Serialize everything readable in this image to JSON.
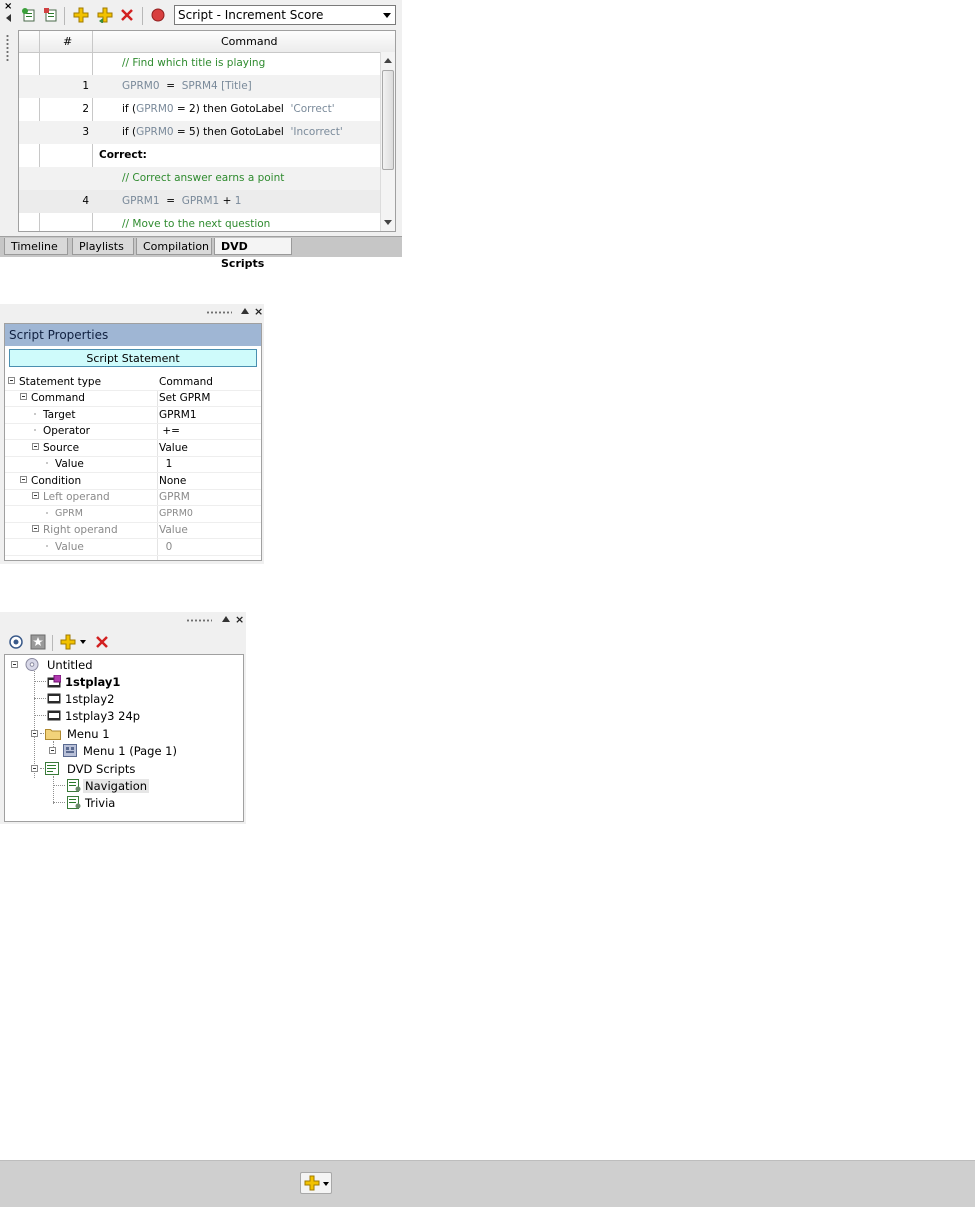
{
  "scripts_panel": {
    "script_selector": {
      "value": "Script - Increment Score"
    },
    "columns": {
      "num": "#",
      "command": "Command"
    },
    "rows": [
      {
        "num": "",
        "type": "comment",
        "text": "// Find which title is playing"
      },
      {
        "num": "1",
        "type": "assign",
        "lhs": "GPRM0",
        "op": "=",
        "rhs": "SPRM4 [Title]"
      },
      {
        "num": "2",
        "type": "if",
        "kw_if": "if (",
        "reg": "GPRM0",
        "cond": " = 2) then ",
        "go": "GotoLabel",
        "label": "'Correct'"
      },
      {
        "num": "3",
        "type": "if",
        "kw_if": "if (",
        "reg": "GPRM0",
        "cond": " = 5) then ",
        "go": "GotoLabel",
        "label": "'Incorrect'"
      },
      {
        "num": "",
        "type": "label",
        "text": "Correct:"
      },
      {
        "num": "",
        "type": "comment",
        "text": "// Correct answer earns a point"
      },
      {
        "num": "4",
        "type": "assign2",
        "lhs": "GPRM1",
        "op": "=",
        "rhs": "GPRM1",
        "plus": "+",
        "val": "1"
      },
      {
        "num": "",
        "type": "comment",
        "text": "// Move to the next question"
      }
    ],
    "tabs": [
      {
        "label": "Timeline",
        "active": false
      },
      {
        "label": "Playlists",
        "active": false
      },
      {
        "label": "Compilation",
        "active": false
      },
      {
        "label": "DVD Scripts",
        "active": true
      }
    ]
  },
  "props_panel": {
    "title": "Script Properties",
    "statement_button": "Script Statement",
    "rows": [
      {
        "key": "Statement type",
        "value": "Command",
        "indent": 0,
        "toggle": true,
        "dim": false
      },
      {
        "key": "Command",
        "value": "Set GPRM",
        "indent": 1,
        "toggle": true,
        "dim": false
      },
      {
        "key": "Target",
        "value": "GPRM1",
        "indent": 2,
        "toggle": false,
        "dim": false
      },
      {
        "key": "Operator",
        "value": " +=",
        "indent": 2,
        "toggle": false,
        "dim": false
      },
      {
        "key": "Source",
        "value": "Value",
        "indent": 2,
        "toggle": true,
        "dim": false
      },
      {
        "key": "Value",
        "value": "  1",
        "indent": 3,
        "toggle": false,
        "dim": false
      },
      {
        "key": "Condition",
        "value": "None",
        "indent": 1,
        "toggle": true,
        "dim": false
      },
      {
        "key": "Left operand",
        "value": "GPRM",
        "indent": 2,
        "toggle": true,
        "dim": true
      },
      {
        "key": "GPRM",
        "value": "GPRM0",
        "indent": 3,
        "toggle": false,
        "dim": true
      },
      {
        "key": "Right operand",
        "value": "Value",
        "indent": 2,
        "toggle": true,
        "dim": true
      },
      {
        "key": "Value",
        "value": "  0",
        "indent": 3,
        "toggle": false,
        "dim": true
      }
    ]
  },
  "tree_panel": {
    "items": [
      {
        "label": "Untitled",
        "icon": "disc-icon",
        "bold": false
      },
      {
        "label": "1stplay1",
        "icon": "first-play-icon",
        "bold": true
      },
      {
        "label": "1stplay2",
        "icon": "film-icon",
        "bold": false
      },
      {
        "label": "1stplay3 24p",
        "icon": "film-icon",
        "bold": false
      },
      {
        "label": "Menu 1",
        "icon": "folder-icon",
        "bold": false
      },
      {
        "label": "Menu 1 (Page 1)",
        "icon": "menu-page-icon",
        "bold": false
      },
      {
        "label": "DVD Scripts",
        "icon": "scripts-folder-icon",
        "bold": false
      },
      {
        "label": "Navigation",
        "icon": "script-icon",
        "bold": false
      },
      {
        "label": "Trivia",
        "icon": "script-icon",
        "bold": false
      }
    ]
  },
  "colors": {
    "comment": "#2f8b2f",
    "register": "#7a8a9a",
    "props_header": "#9fb6d4",
    "statement_button": "#cffbfb",
    "delete_red": "#d22020",
    "add_gold": "#e8b400"
  }
}
